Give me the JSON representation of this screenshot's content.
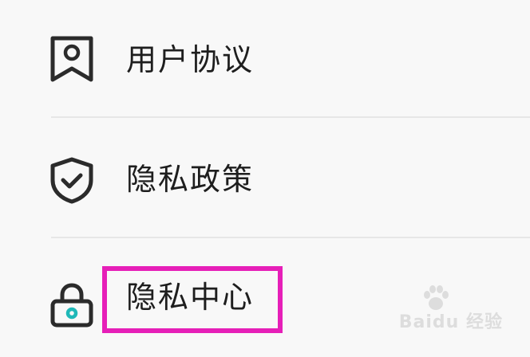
{
  "menu": {
    "items": [
      {
        "label": "用户协议",
        "icon": "bookmark-user-icon"
      },
      {
        "label": "隐私政策",
        "icon": "shield-check-icon"
      },
      {
        "label": "隐私中心",
        "icon": "lock-icon"
      }
    ]
  },
  "annotation": {
    "highlight_color": "#e61fb8"
  },
  "watermark": {
    "text": "Baidu 经验"
  },
  "colors": {
    "background": "#f8f8f8",
    "text": "#1e1e1e",
    "icon_stroke": "#2b2b2b",
    "lock_accent": "#1fb8b8",
    "divider": "#e7e7e7"
  }
}
